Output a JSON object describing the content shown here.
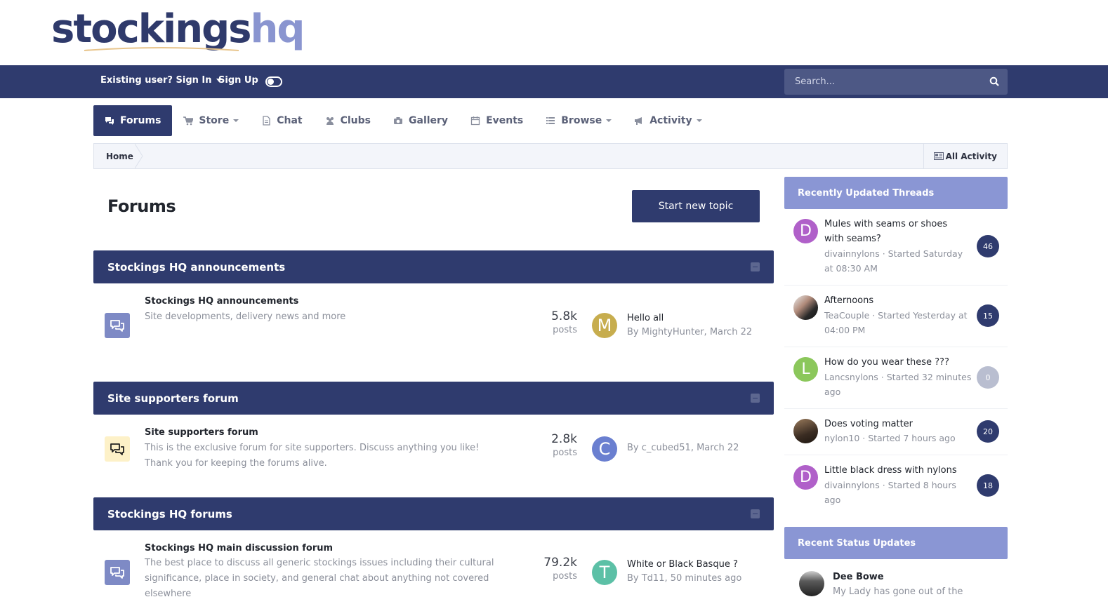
{
  "logo": {
    "part1": "stockings",
    "part2": "hq"
  },
  "userbar": {
    "signin_label": "Existing user? Sign In",
    "signup_label": "Sign Up",
    "search_placeholder": "Search..."
  },
  "nav": {
    "items": [
      {
        "label": "Forums",
        "icon": "comments-icon"
      },
      {
        "label": "Store",
        "icon": "cart-icon"
      },
      {
        "label": "Chat",
        "icon": "document-icon"
      },
      {
        "label": "Clubs",
        "icon": "users-icon"
      },
      {
        "label": "Gallery",
        "icon": "camera-icon"
      },
      {
        "label": "Events",
        "icon": "calendar-icon"
      },
      {
        "label": "Browse",
        "icon": "list-icon"
      },
      {
        "label": "Activity",
        "icon": "bullhorn-icon"
      }
    ]
  },
  "breadcrumb": {
    "home": "Home",
    "all_activity": "All Activity"
  },
  "page": {
    "title": "Forums",
    "start_topic": "Start new topic"
  },
  "categories": [
    {
      "title": "Stockings HQ announcements",
      "forum": {
        "title": "Stockings HQ announcements",
        "desc": "Site developments, delivery news and more",
        "posts": "5.8k",
        "posts_label": "posts",
        "avatar_letter": "M",
        "last_title": "Hello all",
        "last_meta": "By MightyHunter, March 22"
      }
    },
    {
      "title": "Site supporters forum",
      "forum": {
        "title": "Site supporters forum",
        "desc": "This is the exclusive forum for site supporters. Discuss anything you like! Thank you for keeping the forums alive.",
        "posts": "2.8k",
        "posts_label": "posts",
        "avatar_letter": "C",
        "last_title": "",
        "last_meta": "By c_cubed51, March 22"
      }
    },
    {
      "title": "Stockings HQ forums",
      "forum": {
        "title": "Stockings HQ main discussion forum",
        "desc": "The best place to discuss all generic stockings issues including their cultural significance, place in society, and general chat about anything not covered elsewhere",
        "posts": "79.2k",
        "posts_label": "posts",
        "avatar_letter": "T",
        "last_title": "White or Black Basque ?",
        "last_meta": "By Td11, 50 minutes ago"
      }
    }
  ],
  "sidebar": {
    "threads_title": "Recently Updated Threads",
    "threads": [
      {
        "letter": "D",
        "title": "Mules with seams or shoes with seams?",
        "meta": "divainnylons · Started Saturday at 08:30 AM",
        "count": "46"
      },
      {
        "letter": "",
        "title": "Afternoons",
        "meta": "TeaCouple · Started Yesterday at 04:00 PM",
        "count": "15"
      },
      {
        "letter": "L",
        "title": "How do you wear these ???",
        "meta": "Lancsnylons · Started 32 minutes ago",
        "count": "0"
      },
      {
        "letter": "",
        "title": "Does voting matter",
        "meta": "nylon10 · Started 7 hours ago",
        "count": "20"
      },
      {
        "letter": "D",
        "title": "Little black dress with nylons",
        "meta": "divainnylons · Started 8 hours ago",
        "count": "18"
      }
    ],
    "status_title": "Recent Status Updates",
    "status": {
      "name": "Dee Bowe",
      "text": "My Lady has gone out of the"
    }
  },
  "colors": {
    "primary": "#2f3b6e",
    "widget": "#8a96d4"
  }
}
